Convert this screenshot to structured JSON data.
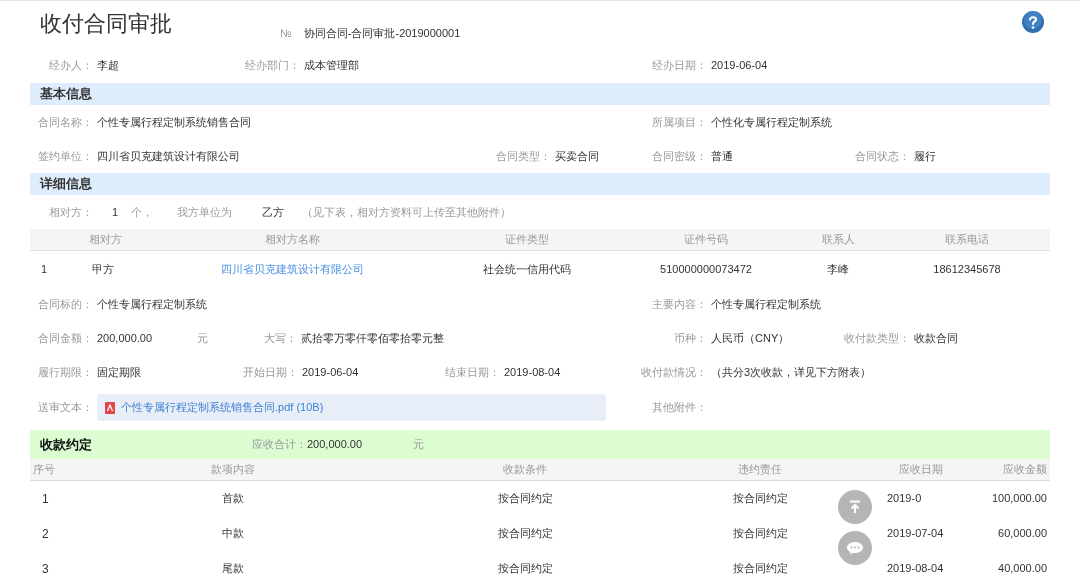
{
  "title": "收付合同审批",
  "number": {
    "mark": "№",
    "value": "协同合同-合同审批-2019000001"
  },
  "meta": {
    "handler": {
      "kind": "text",
      "label": "经办人：",
      "value": "李超"
    },
    "department": {
      "kind": "text",
      "label": "经办部门：",
      "value": "成本管理部"
    },
    "date": {
      "kind": "text",
      "label": "经办日期：",
      "value": "2019-06-04"
    }
  },
  "basic_info": {
    "heading": "基本信息",
    "contract_name": {
      "kind": "text",
      "label": "合同名称：",
      "value": "个性专属行程定制系统销售合同"
    },
    "project": {
      "kind": "text",
      "label": "所属项目：",
      "value": "个性化专属行程定制系统"
    },
    "signing_unit": {
      "kind": "text",
      "label": "签约单位：",
      "value": "四川省贝克建筑设计有限公司"
    },
    "contract_type": {
      "kind": "text",
      "label": "合同类型：",
      "value": "买卖合同"
    },
    "confidentiality": {
      "kind": "text",
      "label": "合同密级：",
      "value": "普通"
    },
    "status": {
      "kind": "text",
      "label": "合同状态：",
      "value": "履行"
    }
  },
  "detail_info": {
    "heading": "详细信息",
    "counterparty_summary": {
      "label": "相对方：",
      "count": "1",
      "count_unit": "个，",
      "role_label": "我方单位为",
      "role": "乙方",
      "note": "（见下表，相对方资料可上传至其他附件）"
    },
    "parties_table": {
      "columns": [
        "相对方",
        "相对方名称",
        "证件类型",
        "证件号码",
        "联系人",
        "联系电话"
      ],
      "rows": [
        {
          "index": "1",
          "party": "甲方",
          "name": "四川省贝克建筑设计有限公司",
          "id_type": "社会统一信用代码",
          "id_number": "510000000073472",
          "contact": "李峰",
          "phone": "18612345678"
        }
      ]
    },
    "subject": {
      "kind": "text",
      "label": "合同标的：",
      "value": "个性专属行程定制系统"
    },
    "main_content": {
      "kind": "text",
      "label": "主要内容：",
      "value": "个性专属行程定制系统"
    },
    "amount": {
      "kind": "amount",
      "label": "合同金额：",
      "value": "200,000.00",
      "unit": "元"
    },
    "amount_in_words": {
      "kind": "text",
      "label": "大写：",
      "value": "贰拾零万零仟零佰零拾零元整"
    },
    "currency": {
      "kind": "text",
      "label": "币种：",
      "value": "人民币（CNY）"
    },
    "payment_type": {
      "kind": "text",
      "label": "收付款类型：",
      "value": "收款合同"
    },
    "term": {
      "kind": "text",
      "label": "履行期限：",
      "value": "固定期限"
    },
    "start_date": {
      "kind": "text",
      "label": "开始日期：",
      "value": "2019-06-04"
    },
    "end_date": {
      "kind": "text",
      "label": "结束日期：",
      "value": "2019-08-04"
    },
    "payment_status": {
      "kind": "text",
      "label": "收付款情况：",
      "value": "（共分3次收款，详见下方附表）"
    },
    "submitted_text": {
      "kind": "attachment",
      "label": "送审文本：",
      "value": "个性专属行程定制系统销售合同.pdf (10B)"
    },
    "other_attachments": {
      "kind": "text",
      "label": "其他附件："
    }
  },
  "payment_terms": {
    "heading": "收款约定",
    "total_label": "应收合计：",
    "total": "200,000.00",
    "total_unit": "元",
    "columns": [
      "序号",
      "款项内容",
      "收款条件",
      "违约责任",
      "应收日期",
      "应收金额"
    ],
    "rows": [
      {
        "index": "1",
        "item": "首款",
        "condition": "按合同约定",
        "liability": "按合同约定",
        "date": "2019-0",
        "amount": "100,000.00"
      },
      {
        "index": "2",
        "item": "中款",
        "condition": "按合同约定",
        "liability": "按合同约定",
        "date": "2019-07-04",
        "amount": "60,000.00"
      },
      {
        "index": "3",
        "item": "尾款",
        "condition": "按合同约定",
        "liability": "按合同约定",
        "date": "2019-08-04",
        "amount": "40,000.00"
      }
    ]
  }
}
